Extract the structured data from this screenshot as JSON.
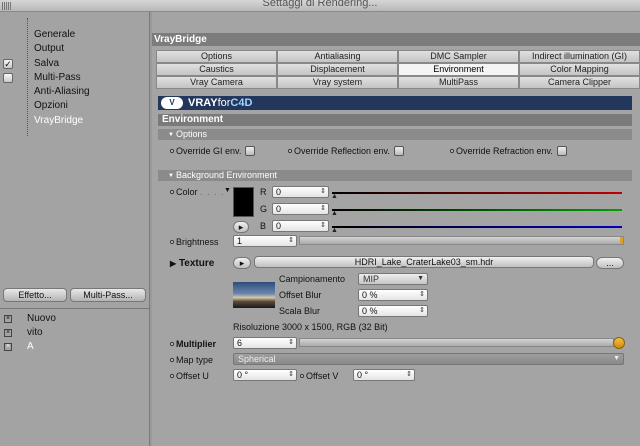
{
  "window": {
    "title": "Settaggi di Rendering..."
  },
  "sidebar": {
    "items": [
      {
        "label": "Generale"
      },
      {
        "label": "Output"
      },
      {
        "label": "Salva",
        "checked": true
      },
      {
        "label": "Multi-Pass",
        "checked": false
      },
      {
        "label": "Anti-Aliasing"
      },
      {
        "label": "Opzioni"
      },
      {
        "label": "VrayBridge",
        "active": true
      }
    ],
    "effect_button": "Effetto...",
    "multipass_button": "Multi-Pass...",
    "render_settings": [
      {
        "label": "Nuovo"
      },
      {
        "label": "vito"
      },
      {
        "label": "A",
        "active": true
      }
    ]
  },
  "panel": {
    "title": "VrayBridge"
  },
  "tabs": {
    "row1": [
      "Options",
      "Antialiasing",
      "DMC Sampler",
      "Indirect illumination (GI)"
    ],
    "row2": [
      "Caustics",
      "Displacement",
      "Environment",
      "Color Mapping"
    ],
    "row3": [
      "Vray Camera",
      "Vray system",
      "MultiPass",
      "Camera Clipper"
    ],
    "selected": "Environment"
  },
  "banner": {
    "logo": "V",
    "brand_white": "VRAY",
    "brand_for": "for",
    "brand_c4d": "C4D"
  },
  "environment": {
    "section_title": "Environment",
    "options": {
      "title": "Options",
      "override_gi": "Override GI env.",
      "override_reflection": "Override Reflection env.",
      "override_refraction": "Override Refraction env."
    },
    "background": {
      "title": "Background Environment",
      "color_label": "Color",
      "r_label": "R",
      "r_value": "0",
      "g_label": "G",
      "g_value": "0",
      "b_label": "B",
      "b_value": "0",
      "brightness_label": "Brightness",
      "brightness_value": "1",
      "texture_label": "Texture",
      "texture_file": "HDRI_Lake_CraterLake03_sm.hdr",
      "browse_label": "...",
      "sampling_label": "Campionamento",
      "sampling_value": "MIP",
      "offset_blur_label": "Offset Blur",
      "offset_blur_value": "0 %",
      "scale_blur_label": "Scala Blur",
      "scale_blur_value": "0 %",
      "resolution": "Risoluzione 3000 x 1500, RGB (32 Bit)",
      "multiplier_label": "Multiplier",
      "multiplier_value": "6",
      "map_type_label": "Map type",
      "map_type_value": "Spherical",
      "offset_u_label": "Offset U",
      "offset_u_value": "0 °",
      "offset_v_label": "Offset V",
      "offset_v_value": "0 °"
    }
  },
  "colors": {
    "banner": "#23365b",
    "red": "#c00000",
    "green": "#00a000",
    "blue": "#0000c0"
  }
}
